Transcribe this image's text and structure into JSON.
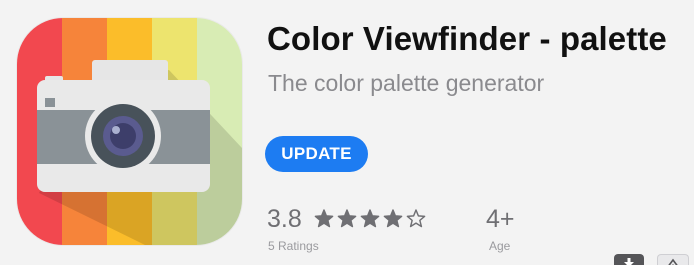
{
  "app": {
    "title": "Color Viewfinder - palette",
    "subtitle": "The color palette generator",
    "action_label": "UPDATE",
    "icon_name": "camera-app-icon",
    "stripe_colors": [
      "#f2484f",
      "#f6843a",
      "#fbbd2a",
      "#ede46e",
      "#d8ecb4"
    ],
    "accent_color": "#1d7cf2"
  },
  "rating": {
    "value": "3.8",
    "stars_filled": 4,
    "stars_total": 5,
    "count_label": "5 Ratings"
  },
  "age": {
    "value": "4+",
    "label": "Age"
  },
  "toolbar": {
    "download_icon": "download-icon",
    "share_icon": "share-icon"
  }
}
